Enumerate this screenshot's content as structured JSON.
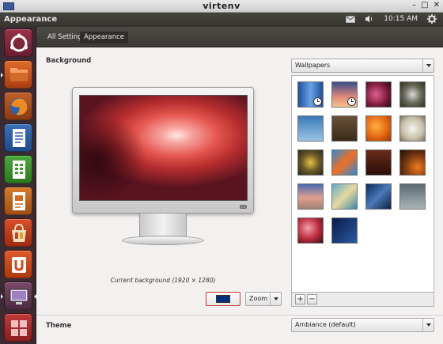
{
  "window": {
    "title": "virtenv",
    "buttons": [
      "–",
      "□",
      "✕"
    ]
  },
  "panel": {
    "app_title": "Appearance",
    "clock": "10:15 AM",
    "indicators": [
      "mail-icon",
      "volume-icon",
      "gear-icon"
    ]
  },
  "launcher": {
    "items": [
      {
        "name": "ubuntu-logo-icon",
        "color": "#7a2a3b"
      },
      {
        "name": "files-icon",
        "color": "#c8541e"
      },
      {
        "name": "firefox-icon",
        "color": "#b8531c"
      },
      {
        "name": "writer-icon",
        "color": "#2a5fa8"
      },
      {
        "name": "calc-icon",
        "color": "#3b9a2e"
      },
      {
        "name": "impress-icon",
        "color": "#c46b1e"
      },
      {
        "name": "software-center-icon",
        "color": "#c5401e"
      },
      {
        "name": "ubuntu-one-icon",
        "color": "#d44a1c"
      },
      {
        "name": "system-settings-icon",
        "color": "#6a3a5a"
      },
      {
        "name": "workspace-switcher-icon",
        "color": "#b03030"
      }
    ]
  },
  "breadcrumb": {
    "all_settings": "All Settings",
    "current": "Appearance"
  },
  "background": {
    "label": "Background",
    "caption": "Current background (1920 × 1280)",
    "color_swatch": "#00307a",
    "placement": "Zoom",
    "source": "Wallpapers"
  },
  "wallpapers": [
    {
      "name": "wallpaper-blue-lines",
      "bg": "linear-gradient(90deg,#1f4fa0,#6aa2e4,#1f4fa0)",
      "timed": true
    },
    {
      "name": "wallpaper-sunset",
      "bg": "linear-gradient(#3a4c8a,#e28a7a 60%,#f3c28c)",
      "timed": true
    },
    {
      "name": "wallpaper-flower-pink",
      "bg": "radial-gradient(circle at 40% 50%,#e06090,#7a1a3a 60%,#2a0a12)",
      "timed": false
    },
    {
      "name": "wallpaper-dandelion",
      "bg": "radial-gradient(circle at 50% 50%,#d8d8d8,#6a6a5a 50%,#2e2e22)",
      "timed": false
    },
    {
      "name": "wallpaper-sky-bird",
      "bg": "linear-gradient(#3a7ab8,#9ac4e4)",
      "timed": false
    },
    {
      "name": "wallpaper-brown-texture",
      "bg": "linear-gradient(#6a5038,#3a2a1a)",
      "timed": false
    },
    {
      "name": "wallpaper-orange-petals",
      "bg": "radial-gradient(circle at 40% 40%,#ffb040,#e06010 60%,#8a3a08)",
      "timed": false
    },
    {
      "name": "wallpaper-white-bloom",
      "bg": "radial-gradient(circle at 50% 50%,#f4f4ee,#c8c0a8 60%,#7a7262)",
      "timed": false
    },
    {
      "name": "wallpaper-leaf-flower",
      "bg": "radial-gradient(circle at 50% 50%,#e8c040,#6a5a2a 50%,#2a2818)",
      "timed": false
    },
    {
      "name": "wallpaper-graffiti",
      "bg": "linear-gradient(135deg,#2a8ad8,#f07020 50%,#2a8ad8)",
      "timed": false
    },
    {
      "name": "wallpaper-dark-red",
      "bg": "linear-gradient(#6a2a1a,#2a0e08)",
      "timed": false
    },
    {
      "name": "wallpaper-orange-ring",
      "bg": "radial-gradient(circle at 70% 70%,#f07a20,#7a3a10 50%,#1a0a04)",
      "timed": false
    },
    {
      "name": "wallpaper-beach",
      "bg": "linear-gradient(#4a6ab0,#e0a090 55%,#a08070)",
      "timed": false
    },
    {
      "name": "wallpaper-mosaic",
      "bg": "linear-gradient(135deg,#5ab0c8,#e8d8a0 50%,#3a8aa8)",
      "timed": false
    },
    {
      "name": "wallpaper-blue-wave",
      "bg": "linear-gradient(135deg,#0a2a5a,#4a7ab8 50%,#0a2040)",
      "timed": false
    },
    {
      "name": "wallpaper-grey-mist",
      "bg": "linear-gradient(#5a6a72,#aab4b8)",
      "timed": false
    },
    {
      "name": "wallpaper-red-bokeh",
      "bg": "radial-gradient(circle at 40% 40%,#f0a0b0,#c03040 50%,#3a0a18)",
      "timed": false
    },
    {
      "name": "wallpaper-night-blue",
      "bg": "linear-gradient(135deg,#0a1a4a,#2a5aa0)",
      "timed": false
    }
  ],
  "theme": {
    "label": "Theme",
    "value": "Ambiance (default)"
  },
  "add_remove": {
    "add": "+",
    "remove": "−"
  }
}
